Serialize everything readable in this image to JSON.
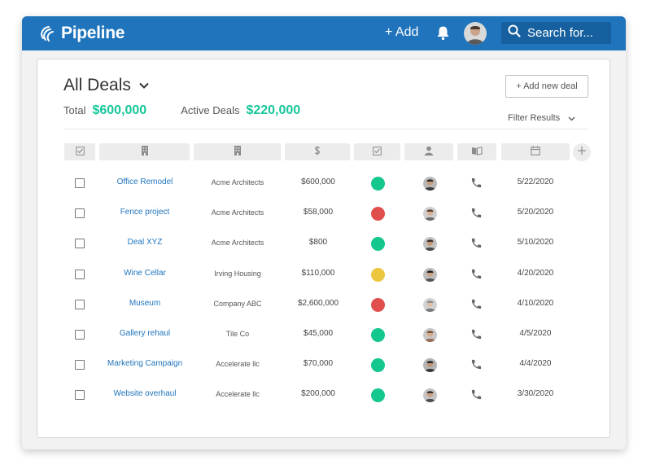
{
  "app": {
    "name": "Pipeline"
  },
  "topbar": {
    "add_label": "+ Add",
    "search_placeholder": "Search for...",
    "icons": [
      "pipeline-logo-icon",
      "bell-icon",
      "search-icon"
    ]
  },
  "header": {
    "title": "All Deals",
    "new_deal_label": "+ Add new deal",
    "total_label": "Total",
    "total_value": "$600,000",
    "active_label": "Active Deals",
    "active_value": "$220,000",
    "filter_label": "Filter Results"
  },
  "columns": [
    {
      "icon": "checkbox-icon"
    },
    {
      "icon": "building-icon"
    },
    {
      "icon": "building-icon"
    },
    {
      "icon": "dollar-icon"
    },
    {
      "icon": "checkbox-icon"
    },
    {
      "icon": "person-icon"
    },
    {
      "icon": "book-icon"
    },
    {
      "icon": "calendar-icon"
    }
  ],
  "colors": {
    "brand": "#1f74bc",
    "green": "#16c79a",
    "won": "#14c78f",
    "lost": "#e04e4e",
    "pending": "#ecc63f"
  },
  "deals": [
    {
      "name": "Office Remodel",
      "company": "Acme Architects",
      "amount": "$600,000",
      "status": "green",
      "date": "5/22/2020"
    },
    {
      "name": "Fence project",
      "company": "Acme Architects",
      "amount": "$58,000",
      "status": "red",
      "date": "5/20/2020"
    },
    {
      "name": "Deal XYZ",
      "company": "Acme Architects",
      "amount": "$800",
      "status": "green",
      "date": "5/10/2020"
    },
    {
      "name": "Wine Cellar",
      "company": "Irving Housing",
      "amount": "$110,000",
      "status": "yellow",
      "date": "4/20/2020"
    },
    {
      "name": "Museum",
      "company": "Company ABC",
      "amount": "$2,600,000",
      "status": "red",
      "date": "4/10/2020"
    },
    {
      "name": "Gallery rehaul",
      "company": "Tile Co",
      "amount": "$45,000",
      "status": "green",
      "date": "4/5/2020"
    },
    {
      "name": "Marketing Campaign",
      "company": "Accelerate llc",
      "amount": "$70,000",
      "status": "green",
      "date": "4/4/2020"
    },
    {
      "name": "Website overhaul",
      "company": "Accelerate llc",
      "amount": "$200,000",
      "status": "green",
      "date": "3/30/2020"
    }
  ]
}
